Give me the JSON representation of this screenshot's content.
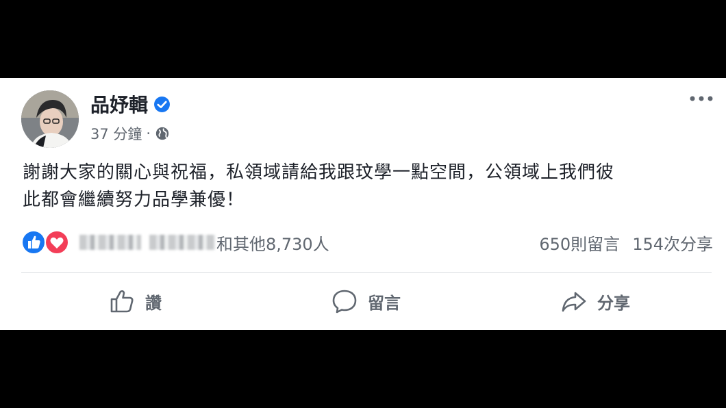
{
  "post": {
    "author": "品妤輯",
    "timestamp": "37 分鐘",
    "separator": "·",
    "text_line1": "謝謝大家的關心與祝福，私領域請給我跟玟學一點空間，公領域上我們彼",
    "text_line2": "此都會繼續努力品學兼優！"
  },
  "reactions": {
    "others_text": "和其他8,730人",
    "comments_count": "650則留言",
    "shares_count": "154次分享",
    "icons": [
      "like-icon",
      "love-icon"
    ]
  },
  "actions": {
    "like_label": "讚",
    "comment_label": "留言",
    "share_label": "分享"
  },
  "colors": {
    "frame": "#000000",
    "card": "#ffffff",
    "text": "#1d2129",
    "secondary": "#606770",
    "like_blue": "#1877f2",
    "love_red": "#f33e58",
    "verified_blue": "#1877f2"
  }
}
